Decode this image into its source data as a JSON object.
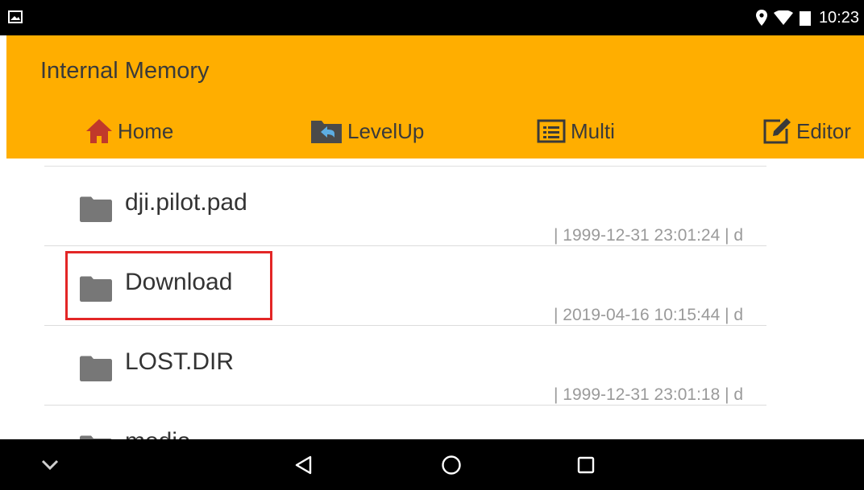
{
  "status_bar": {
    "time": "10:23",
    "icons": [
      "image-icon",
      "location-icon",
      "wifi-icon",
      "battery-icon"
    ]
  },
  "header": {
    "title": "Internal Memory",
    "background_color": "#FFAE00",
    "toolbar": [
      {
        "label": "Home",
        "icon": "home-icon"
      },
      {
        "label": "LevelUp",
        "icon": "folder-levelup-icon"
      },
      {
        "label": "Multi",
        "icon": "multi-select-icon"
      },
      {
        "label": "Editor",
        "icon": "edit-icon"
      }
    ]
  },
  "file_list": {
    "items": [
      {
        "name": "dji.pilot.pad",
        "meta": "| 1999-12-31 23:01:24 | d",
        "icon": "folder-icon"
      },
      {
        "name": "Download",
        "meta": "| 2019-04-16 10:15:44 | d",
        "icon": "folder-icon",
        "highlighted": true
      },
      {
        "name": "LOST.DIR",
        "meta": "| 1999-12-31 23:01:18 | d",
        "icon": "folder-icon"
      },
      {
        "name": "media",
        "meta": "",
        "icon": "folder-icon"
      }
    ]
  },
  "nav_bar": {
    "buttons": [
      "collapse-chevron-icon",
      "back-icon",
      "home-circle-icon",
      "recents-square-icon"
    ]
  }
}
